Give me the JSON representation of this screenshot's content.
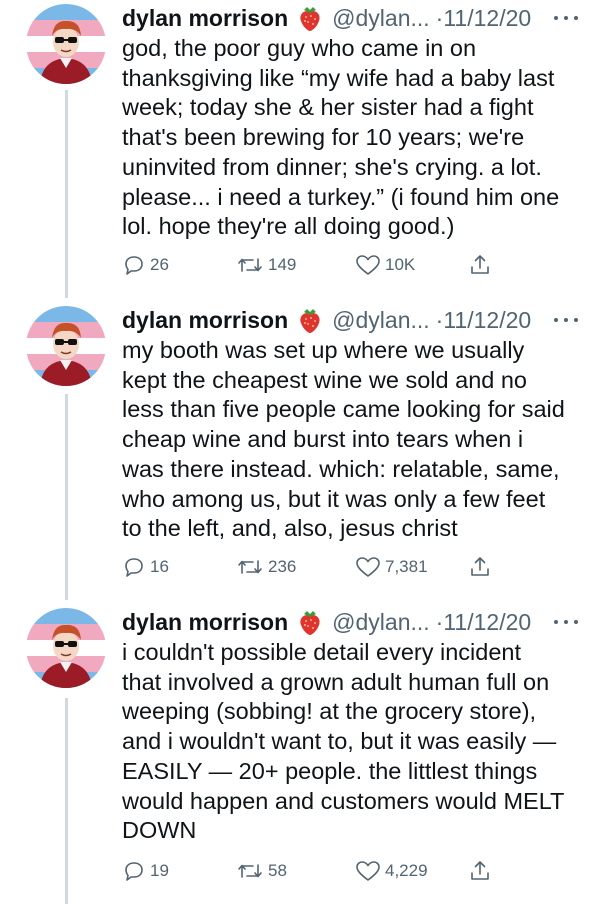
{
  "tweets": [
    {
      "name": "dylan morrison",
      "emoji": "strawberry-icon",
      "handle": "@dylan...",
      "separator": "·",
      "date": "11/12/20",
      "text": "god, the poor guy who came in on\nthanksgiving like “my wife had a baby last\nweek; today she & her sister had a fight\nthat's been brewing for 10 years; we're\nuninvited from dinner; she's crying. a lot.\nplease... i need a turkey.” (i found him one\nlol. hope they're all doing good.)",
      "replies": "26",
      "retweets": "149",
      "likes": "10K"
    },
    {
      "name": "dylan morrison",
      "emoji": "strawberry-icon",
      "handle": "@dylan...",
      "separator": "·",
      "date": "11/12/20",
      "text": "my booth was set up where we usually\nkept the cheapest wine we sold and no\nless than five people came looking for said\ncheap wine and burst into tears when i\nwas there instead. which: relatable, same,\nwho among us, but it was only a few feet\nto the left, and, also, jesus christ",
      "replies": "16",
      "retweets": "236",
      "likes": "7,381"
    },
    {
      "name": "dylan morrison",
      "emoji": "strawberry-icon",
      "handle": "@dylan...",
      "separator": "·",
      "date": "11/12/20",
      "text": "i couldn't possible detail every incident\nthat involved a grown adult human full on\nweeping (sobbing! at the grocery store),\nand i wouldn't want to, but it was easily —\nEASILY — 20+ people. the littlest things\nwould happen and customers would MELT\nDOWN",
      "replies": "19",
      "retweets": "58",
      "likes": "4,229"
    }
  ],
  "colors": {
    "flag_blue": "#7bb8e8",
    "flag_pink": "#f1a9c0",
    "flag_white": "#ffffff",
    "secondary_text": "#536471",
    "thread_line": "#cfd9de",
    "strawberry": "#e0342f"
  }
}
